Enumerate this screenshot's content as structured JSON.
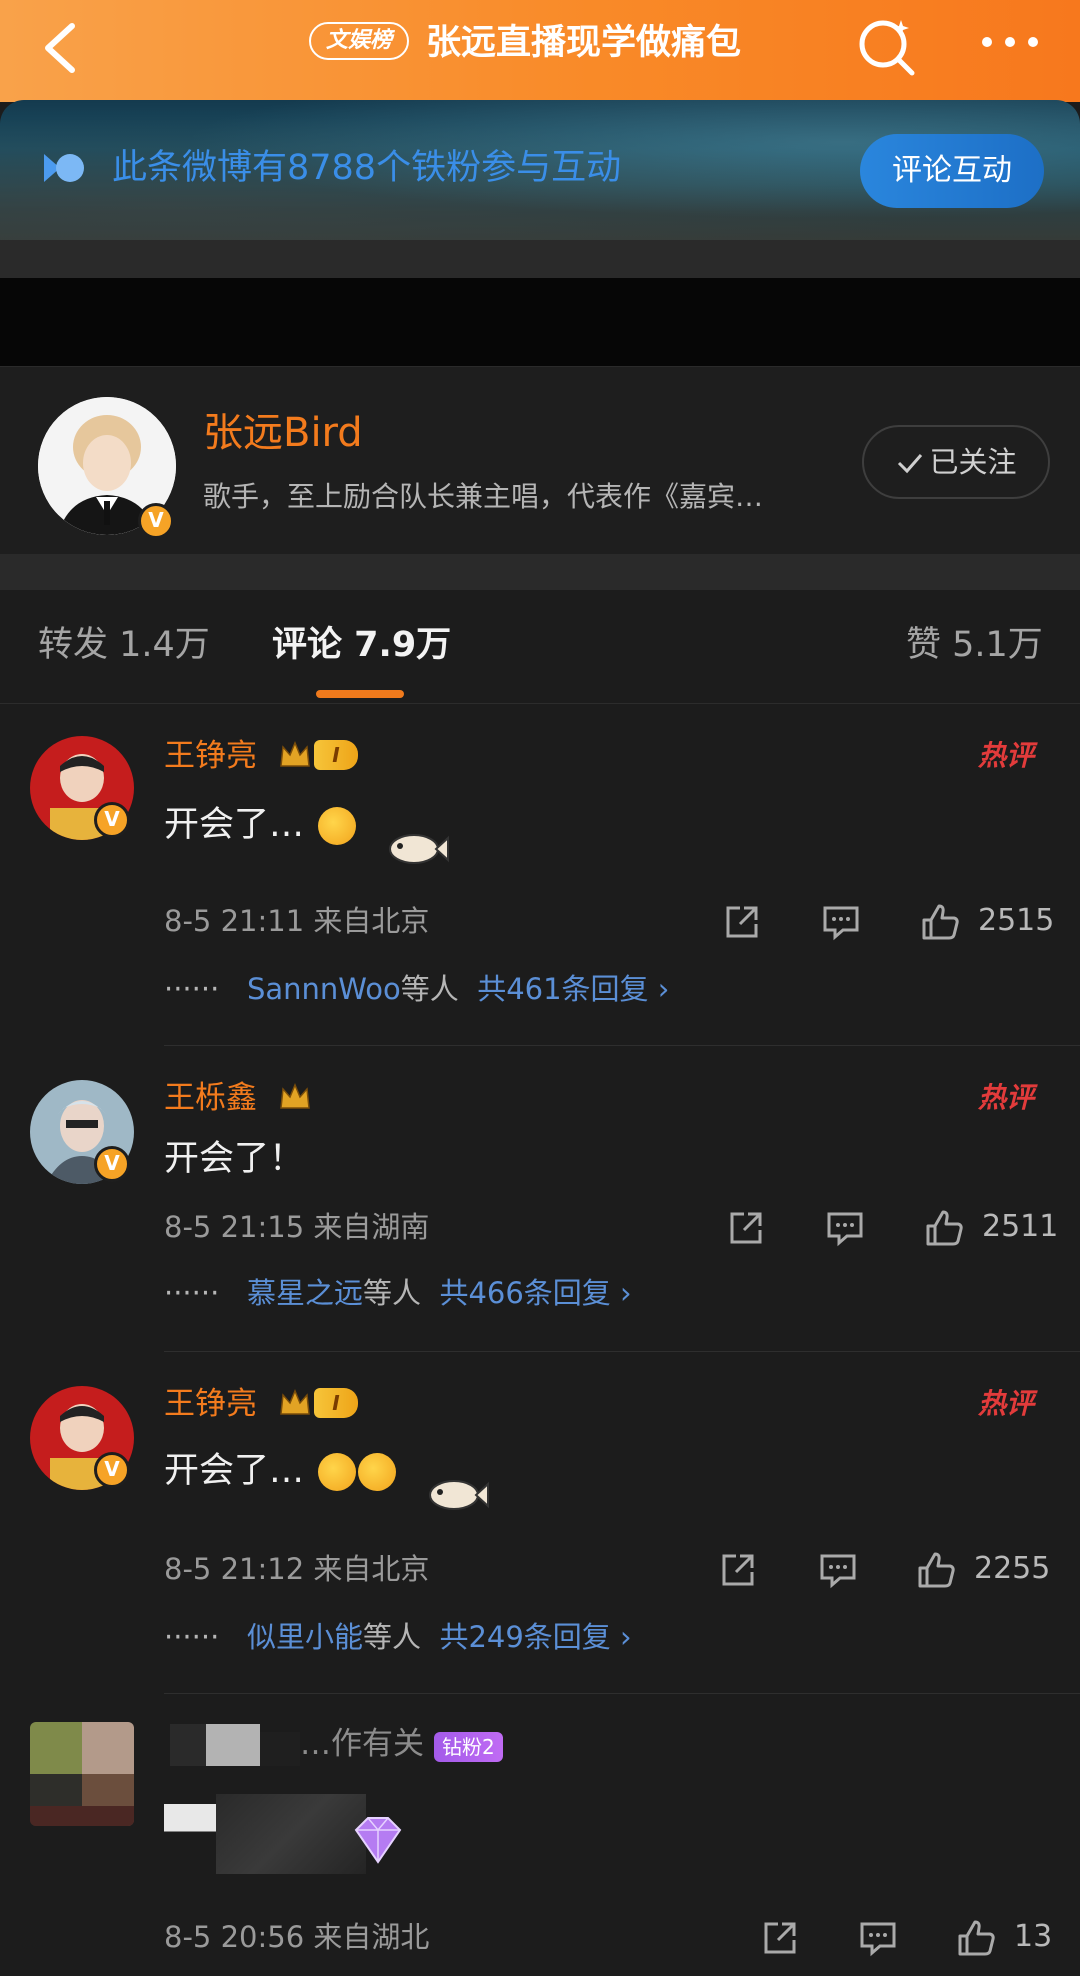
{
  "header": {
    "badge": "文娱榜",
    "title": "张远直播现学做痛包"
  },
  "banner": {
    "text": "此条微博有8788个铁粉参与互动",
    "button": "评论互动"
  },
  "author": {
    "name": "张远Bird",
    "desc": "歌手，至上励合队长兼主唱，代表作《嘉宾…",
    "verified_mark": "V",
    "follow_label": "已关注"
  },
  "tabs": {
    "repost": "转发 1.4万",
    "comment": "评论 7.9万",
    "like": "赞 5.1万"
  },
  "comments": [
    {
      "name": "王铮亮",
      "level": "I",
      "text": "开会了…",
      "time": "8-5 21:11 来自北京",
      "likes": "2515",
      "reply_users": "SannnWoo",
      "reply_mid": "等人",
      "reply_total": "共461条回复 ›",
      "hot": "热评",
      "dots": "······"
    },
    {
      "name": "王栎鑫",
      "text": "开会了！",
      "time": "8-5 21:15 来自湖南",
      "likes": "2511",
      "reply_users": "慕星之远",
      "reply_mid": "等人",
      "reply_total": "共466条回复 ›",
      "hot": "热评",
      "dots": "······"
    },
    {
      "name": "王铮亮",
      "level": "I",
      "text": "开会了…",
      "time": "8-5 21:12 来自北京",
      "likes": "2255",
      "reply_users": "似里小能",
      "reply_mid": "等人",
      "reply_total": "共249条回复 ›",
      "hot": "热评",
      "dots": "······"
    },
    {
      "name_partial": "…作有关",
      "badge": "钻粉2",
      "time": "8-5 20:56 来自湖北",
      "likes": "13"
    }
  ],
  "colors": {
    "brand_orange": "#f37b1d",
    "link_blue": "#5b8fd6",
    "background": "#1c1c1c"
  }
}
